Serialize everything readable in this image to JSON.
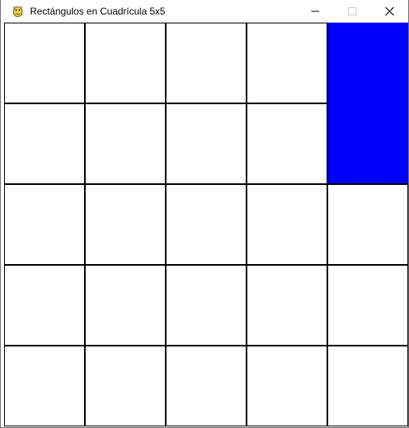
{
  "window": {
    "title": "Rectángulos en Cuadrícula 5x5",
    "app_icon": "pygame-snake-icon",
    "controls": {
      "minimize_icon": "minimize-icon",
      "maximize_icon": "maximize-icon",
      "close_icon": "close-icon"
    }
  },
  "grid": {
    "rows": 5,
    "cols": 5,
    "background_color": "#ffffff",
    "line_color": "#000000",
    "highlight_color": "#0000ff",
    "highlight": {
      "col": 4,
      "row_start": 0,
      "row_end": 1
    }
  }
}
